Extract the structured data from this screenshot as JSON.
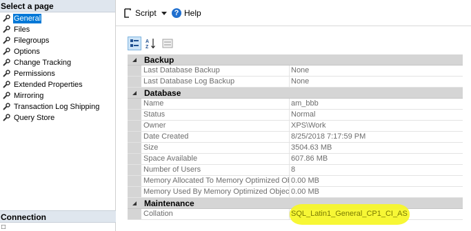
{
  "left": {
    "header": "Select a page",
    "pages": [
      {
        "label": "General",
        "selected": true
      },
      {
        "label": "Files"
      },
      {
        "label": "Filegroups"
      },
      {
        "label": "Options"
      },
      {
        "label": "Change Tracking"
      },
      {
        "label": "Permissions"
      },
      {
        "label": "Extended Properties"
      },
      {
        "label": "Mirroring"
      },
      {
        "label": "Transaction Log Shipping"
      },
      {
        "label": "Query Store"
      }
    ],
    "connection_header": "Connection"
  },
  "toolbar": {
    "script_label": "Script",
    "help_label": "Help"
  },
  "grid": {
    "backup": {
      "title": "Backup",
      "rows": [
        {
          "name": "Last Database Backup",
          "value": "None"
        },
        {
          "name": "Last Database Log Backup",
          "value": "None"
        }
      ]
    },
    "database": {
      "title": "Database",
      "rows": [
        {
          "name": "Name",
          "value": "am_bbb"
        },
        {
          "name": "Status",
          "value": "Normal"
        },
        {
          "name": "Owner",
          "value": "XPS\\Work"
        },
        {
          "name": "Date Created",
          "value": "8/25/2018 7:17:59 PM"
        },
        {
          "name": "Size",
          "value": "3504.63 MB"
        },
        {
          "name": "Space Available",
          "value": "607.86 MB"
        },
        {
          "name": "Number of Users",
          "value": "8"
        },
        {
          "name": "Memory Allocated To Memory Optimized Obj",
          "value": "0.00 MB"
        },
        {
          "name": "Memory Used By Memory Optimized Objects",
          "value": "0.00 MB"
        }
      ]
    },
    "maintenance": {
      "title": "Maintenance",
      "rows": [
        {
          "name": "Collation",
          "value": "SQL_Latin1_General_CP1_CI_AS"
        }
      ]
    }
  },
  "colors": {
    "selection": "#0078d7",
    "highlight": "#f7f72a",
    "category_bg": "#d5d5d5"
  }
}
